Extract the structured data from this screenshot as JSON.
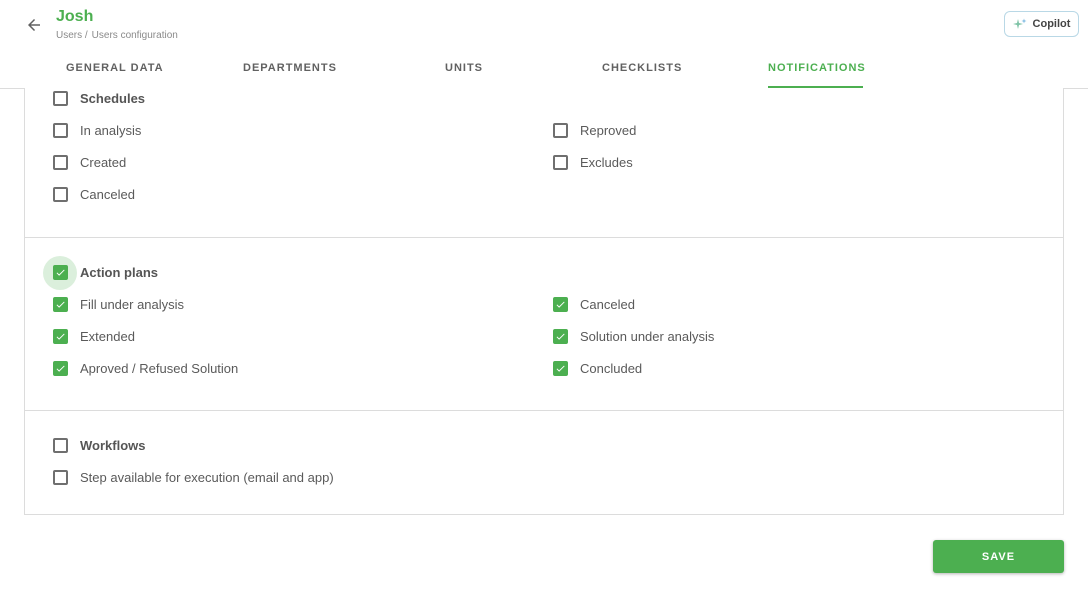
{
  "header": {
    "title": "Josh",
    "breadcrumb": [
      "Users /",
      "Users configuration"
    ],
    "copilot_label": "Copilot",
    "accent_color": "#4caf50"
  },
  "tabs": [
    {
      "label": "GENERAL DATA",
      "active": false
    },
    {
      "label": "DEPARTMENTS",
      "active": false
    },
    {
      "label": "UNITS",
      "active": false
    },
    {
      "label": "CHECKLISTS",
      "active": false
    },
    {
      "label": "NOTIFICATIONS",
      "active": true
    }
  ],
  "sections": {
    "schedules": {
      "title": "Schedules",
      "checked": false,
      "items": [
        {
          "label": "In analysis",
          "checked": false
        },
        {
          "label": "Reproved",
          "checked": false
        },
        {
          "label": "Created",
          "checked": false
        },
        {
          "label": "Excludes",
          "checked": false
        },
        {
          "label": "Canceled",
          "checked": false
        }
      ]
    },
    "action_plans": {
      "title": "Action plans",
      "checked": true,
      "items": [
        {
          "label": "Fill under analysis",
          "checked": true
        },
        {
          "label": "Canceled",
          "checked": true
        },
        {
          "label": "Extended",
          "checked": true
        },
        {
          "label": "Solution under analysis",
          "checked": true
        },
        {
          "label": "Aproved / Refused Solution",
          "checked": true
        },
        {
          "label": "Concluded",
          "checked": true
        }
      ]
    },
    "workflows": {
      "title": "Workflows",
      "checked": false,
      "items": [
        {
          "label": "Step available for execution (email and app)",
          "checked": false
        }
      ]
    }
  },
  "footer": {
    "save_label": "SAVE"
  }
}
